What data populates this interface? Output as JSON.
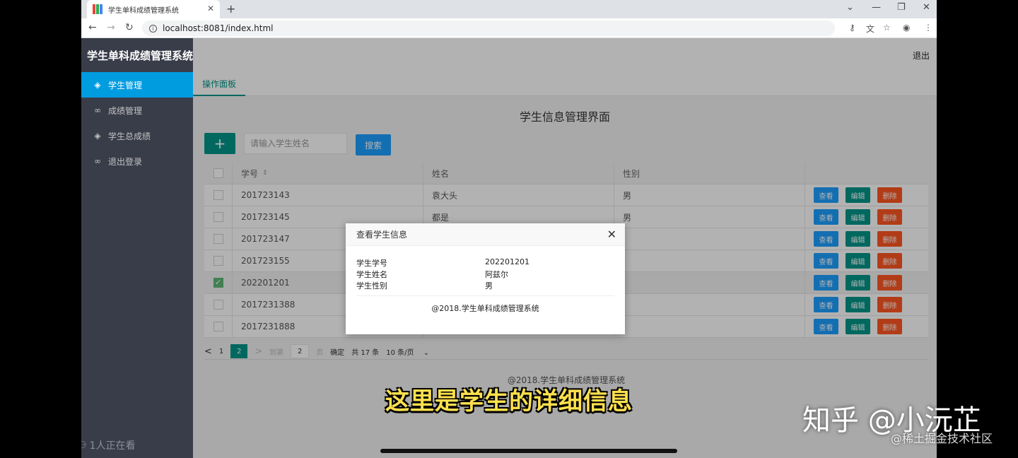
{
  "browser": {
    "tab_title": "学生单科成绩管理系统",
    "url": "localhost:8081/index.html",
    "favicon_colors": [
      "#e8453c",
      "#34a853",
      "#4285f4"
    ]
  },
  "app": {
    "brand": "学生单科成绩管理系统",
    "logout_label": "退出",
    "sidebar": {
      "items": [
        {
          "label": "学生管理",
          "icon": "layers-icon"
        },
        {
          "label": "成绩管理",
          "icon": "link-icon"
        },
        {
          "label": "学生总成绩",
          "icon": "layers-icon"
        },
        {
          "label": "退出登录",
          "icon": "link-icon"
        }
      ],
      "active_index": 0
    },
    "tabs": [
      {
        "label": "操作面板"
      }
    ],
    "page_title": "学生信息管理界面",
    "toolbar": {
      "add_label": "+",
      "search_placeholder": "请输入学生姓名",
      "search_label": "搜索"
    },
    "table": {
      "columns": [
        "学号",
        "姓名",
        "性别"
      ],
      "rows": [
        {
          "id": "201723143",
          "name": "袁大头",
          "sex": "男",
          "checked": false
        },
        {
          "id": "201723145",
          "name": "都是",
          "sex": "男",
          "checked": false
        },
        {
          "id": "201723147",
          "name": "",
          "sex": "",
          "checked": false
        },
        {
          "id": "201723155",
          "name": "",
          "sex": "",
          "checked": false
        },
        {
          "id": "202201201",
          "name": "",
          "sex": "",
          "checked": true
        },
        {
          "id": "2017231388",
          "name": "",
          "sex": "",
          "checked": false
        },
        {
          "id": "2017231888",
          "name": "",
          "sex": "",
          "checked": false
        }
      ],
      "row_actions": {
        "view": "查看",
        "edit": "编辑",
        "delete": "删除"
      }
    },
    "pagination": {
      "prev": "<",
      "page1": "1",
      "current": "2",
      "next": ">",
      "goto_label": "到第",
      "goto_value": "2",
      "page_unit": "页",
      "confirm": "确定",
      "total": "共 17 条",
      "page_size": "10 条/页"
    },
    "footer": "@2018.学生单科成绩管理系统"
  },
  "modal": {
    "title": "查看学生信息",
    "fields": [
      {
        "label": "学生学号",
        "value": "202201201"
      },
      {
        "label": "学生姓名",
        "value": "阿兹尔"
      },
      {
        "label": "学生性别",
        "value": "男"
      }
    ],
    "footer": "@2018.学生单科成绩管理系统"
  },
  "overlay": {
    "caption": "这里是学生的详细信息",
    "watermark_zhihu": "知乎 @小沅芷",
    "watermark_juejin": "@稀土掘金技术社区",
    "viewers": "1人正在看"
  }
}
